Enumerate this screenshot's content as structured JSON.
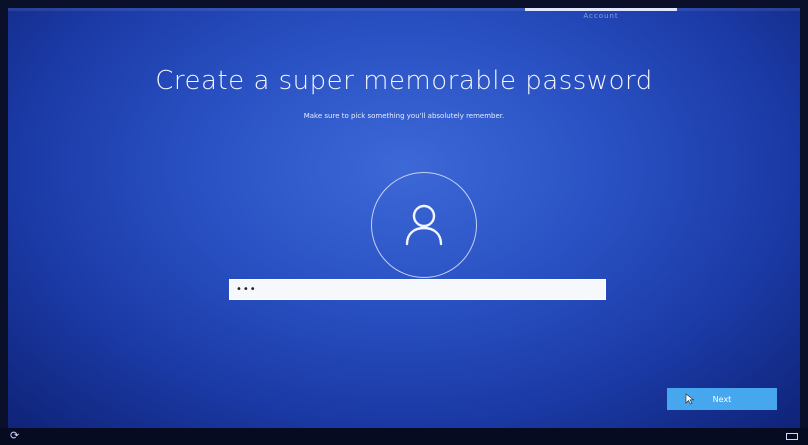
{
  "window": {
    "section_label": "Account"
  },
  "page": {
    "title": "Create a super memorable password",
    "subtitle": "Make sure to pick something you'll absolutely remember."
  },
  "password": {
    "value": "•••"
  },
  "buttons": {
    "next_label": "Next"
  },
  "icons": {
    "avatar": "user-icon",
    "cursor": "mouse-pointer-icon",
    "ease_of_access": "ease-of-access-icon",
    "keyboard": "keyboard-icon"
  },
  "colors": {
    "background": "#2a52c4",
    "accent_button": "#46a6ee",
    "text": "#f3f6ff"
  }
}
